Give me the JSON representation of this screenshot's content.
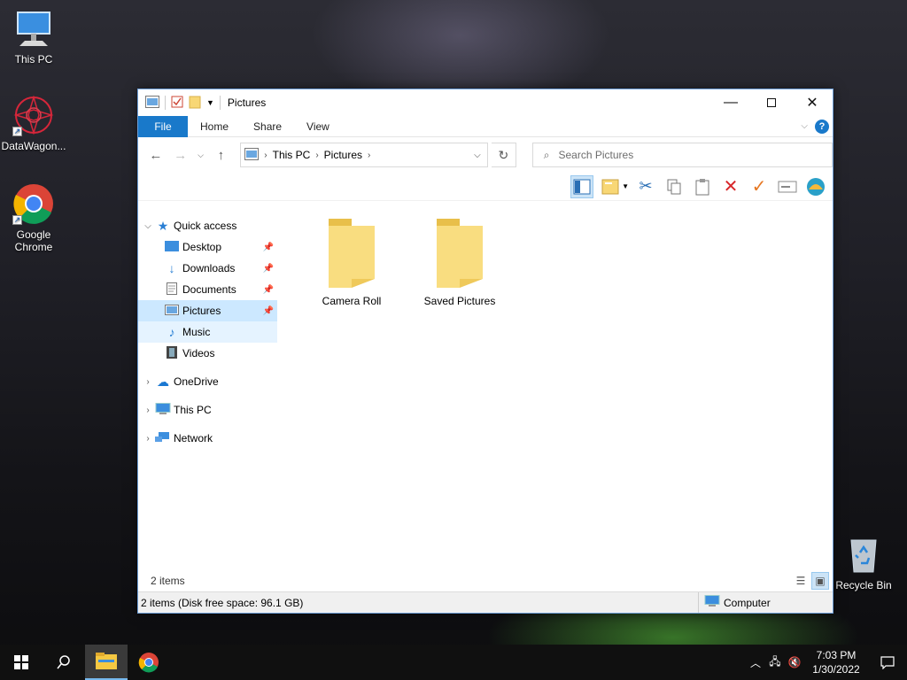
{
  "desktop": {
    "icons": [
      {
        "label": "This PC"
      },
      {
        "label": "DataWagon..."
      },
      {
        "label": "Google\nChrome"
      },
      {
        "label": "Recycle Bin"
      }
    ]
  },
  "window": {
    "title": "Pictures",
    "ribbon_tabs": [
      "File",
      "Home",
      "Share",
      "View"
    ],
    "help_label": "?",
    "address": {
      "crumbs": [
        "This PC",
        "Pictures"
      ]
    },
    "search": {
      "placeholder": "Search Pictures"
    },
    "nav_pane": {
      "quick_access": "Quick access",
      "quick_items": [
        {
          "label": "Desktop",
          "pinned": true
        },
        {
          "label": "Downloads",
          "pinned": true
        },
        {
          "label": "Documents",
          "pinned": true
        },
        {
          "label": "Pictures",
          "pinned": true,
          "selected": true
        },
        {
          "label": "Music",
          "pinned": false
        },
        {
          "label": "Videos",
          "pinned": false
        }
      ],
      "onedrive": "OneDrive",
      "this_pc": "This PC",
      "network": "Network"
    },
    "files": [
      {
        "name": "Camera Roll"
      },
      {
        "name": "Saved Pictures"
      }
    ],
    "item_count": "2 items",
    "status": {
      "left": "2 items (Disk free space: 96.1 GB)",
      "right": "Computer"
    }
  },
  "taskbar": {
    "time": "7:03 PM",
    "date": "1/30/2022"
  },
  "colors": {
    "accent": "#1979ca",
    "selection": "#cce8ff"
  }
}
